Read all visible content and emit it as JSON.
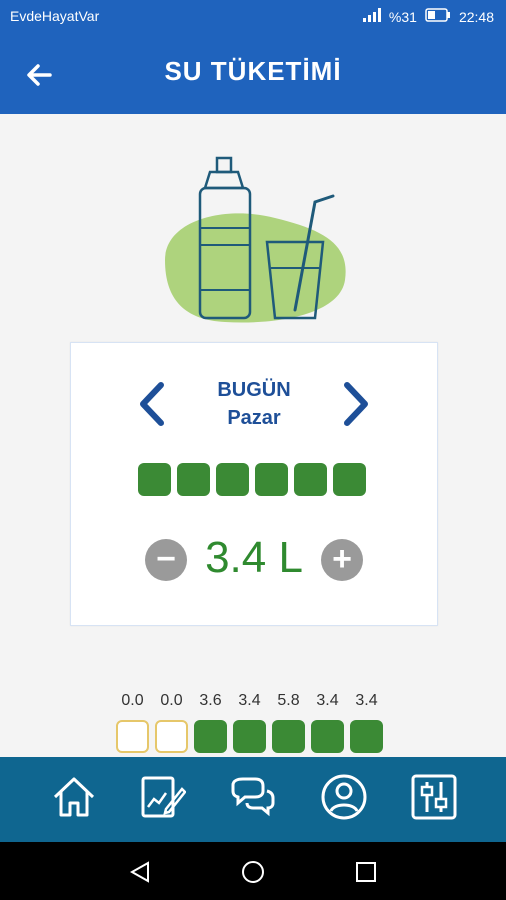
{
  "status_bar": {
    "app_name": "EvdeHayatVar",
    "battery": "%31",
    "time": "22:48"
  },
  "header": {
    "title": "SU TÜKETİMİ"
  },
  "card": {
    "day_title": "BUGÜN",
    "day_name": "Pazar",
    "amount": "3.4 L",
    "cups_filled": 6
  },
  "week": [
    {
      "value": "0.0",
      "state": "empty"
    },
    {
      "value": "0.0",
      "state": "empty"
    },
    {
      "value": "3.6",
      "state": "full"
    },
    {
      "value": "3.4",
      "state": "full"
    },
    {
      "value": "5.8",
      "state": "full"
    },
    {
      "value": "3.4",
      "state": "full"
    },
    {
      "value": "3.4",
      "state": "full"
    }
  ],
  "tabbar": {
    "icons": [
      "home-icon",
      "edit-chart-icon",
      "chat-icon",
      "profile-icon",
      "settings-sliders-icon"
    ]
  }
}
